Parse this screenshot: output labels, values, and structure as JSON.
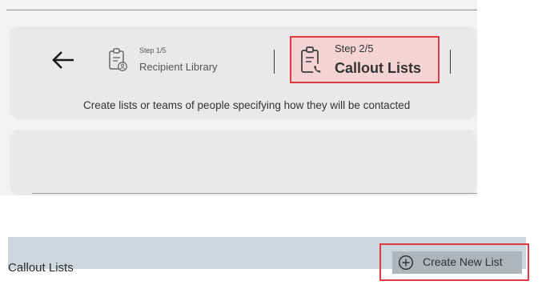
{
  "wizard": {
    "back_icon": "arrow-left-icon",
    "steps": [
      {
        "counter": "Step 1/5",
        "label": "Recipient Library",
        "icon": "clipboard-person-icon",
        "active": false
      },
      {
        "counter": "Step 2/5",
        "label": "Callout Lists",
        "icon": "clipboard-phone-icon",
        "active": true
      }
    ],
    "subtitle": "Create lists or teams of people specifying how they will be contacted"
  },
  "callout_lists": {
    "title": "Callout Lists",
    "create_button": {
      "label": "Create New List",
      "icon": "plus-circle-icon"
    }
  },
  "colors": {
    "highlight_border": "#e13a43",
    "active_step_bg": "#f3d3d4",
    "bar_bg": "#cdd6dd",
    "panel_bg": "#e9e9e9"
  }
}
